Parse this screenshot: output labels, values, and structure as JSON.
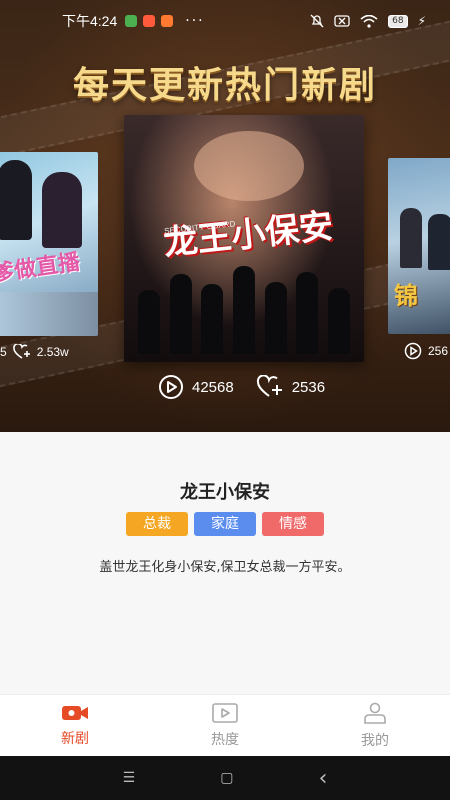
{
  "status_bar": {
    "time": "下午4:24",
    "more": "···",
    "battery": "68",
    "dot_colors": [
      "#4caf50",
      "#ff5a3c",
      "#ff7a30"
    ]
  },
  "hero": {
    "headline": "每天更新热门新剧",
    "main_poster": {
      "title": "龙王小保安",
      "subtitle_en": "SECURITY GUARD",
      "plays": "42568",
      "likes": "2536"
    },
    "left_poster": {
      "overlay_text": "爹做直播",
      "plays_partial": "5",
      "likes": "2.53w"
    },
    "right_poster": {
      "overlay_text": "锦",
      "plays_partial": "256"
    }
  },
  "detail": {
    "title": "龙王小保安",
    "tags": [
      {
        "label": "总裁",
        "color": "#f5a623"
      },
      {
        "label": "家庭",
        "color": "#5b8def"
      },
      {
        "label": "情感",
        "color": "#f06a6a"
      }
    ],
    "description": "盖世龙王化身小保安,保卫女总裁一方平安。"
  },
  "bottom_nav": {
    "items": [
      {
        "label": "新剧",
        "icon": "camera-icon",
        "active": true
      },
      {
        "label": "热度",
        "icon": "play-box-icon",
        "active": false
      },
      {
        "label": "我的",
        "icon": "user-icon",
        "active": false
      }
    ]
  },
  "system_nav": {
    "menu_glyph": "☰",
    "home_glyph": "▢",
    "back_glyph": "‹"
  },
  "colors": {
    "accent": "#e64b28",
    "headline": "#f6d98b"
  }
}
